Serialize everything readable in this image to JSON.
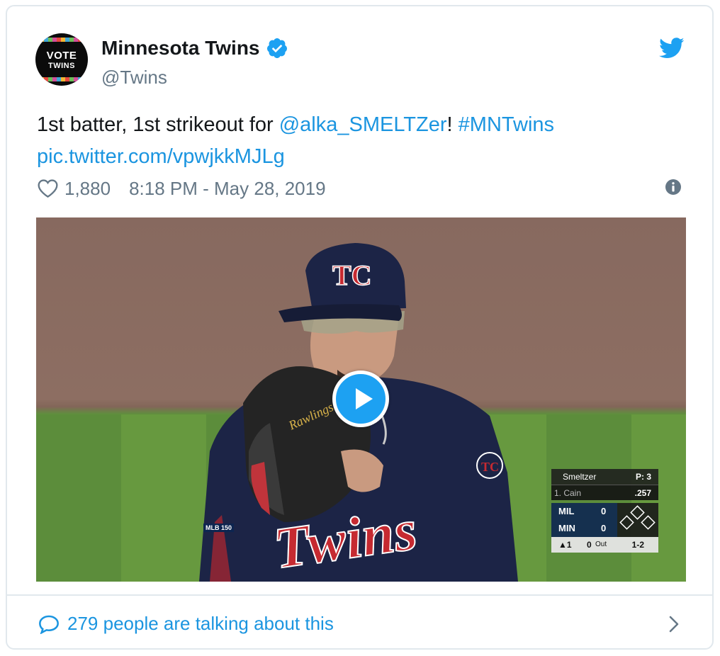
{
  "account": {
    "display_name": "Minnesota Twins",
    "handle": "@Twins",
    "avatar_line1": "VOTE",
    "avatar_line2": "TWINS",
    "verified": true
  },
  "tweet": {
    "text_prefix": "1st batter, 1st strikeout for ",
    "mention": "@alka_SMELTZer",
    "exclaim": "!",
    "hashtag": "#MNTwins",
    "media_link": "pic.twitter.com/vpwjkkMJLg"
  },
  "meta": {
    "like_count": "1,880",
    "timestamp": "8:18 PM - May 28, 2019"
  },
  "scoreboard": {
    "pitcher": "Smeltzer",
    "pitch_count": "P: 3",
    "batter": "1. Cain",
    "batter_avg": ".257",
    "away_team": "MIL",
    "away_score": "0",
    "home_team": "MIN",
    "home_score": "0",
    "inning": "▲1",
    "outs": "0",
    "outs_label": "Out",
    "count": "1-2"
  },
  "video_badge": "MLB 150",
  "footer": {
    "talking_text": "279 people are talking about this"
  },
  "colors": {
    "link": "#1b95e0",
    "verified": "#1da1f2",
    "muted": "#657786",
    "border": "#e1e8ed"
  },
  "icons": [
    "verified-badge-icon",
    "twitter-bird-icon",
    "heart-icon",
    "info-icon",
    "play-icon",
    "comment-icon",
    "chevron-right-icon"
  ]
}
